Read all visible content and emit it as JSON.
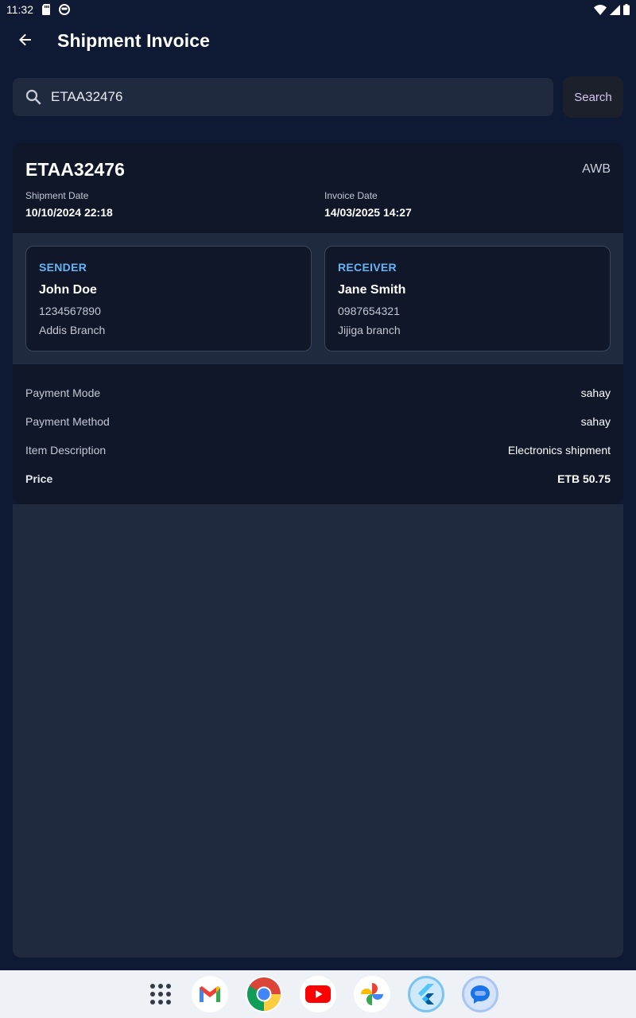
{
  "status_bar": {
    "time": "11:32"
  },
  "header": {
    "title": "Shipment Invoice"
  },
  "search": {
    "value": "ETAA32476",
    "button_label": "Search"
  },
  "invoice": {
    "awb_number": "ETAA32476",
    "awb_type": "AWB",
    "shipment_date_label": "Shipment Date",
    "shipment_date": "10/10/2024 22:18",
    "invoice_date_label": "Invoice Date",
    "invoice_date": "14/03/2025 14:27",
    "sender": {
      "role": "SENDER",
      "name": "John Doe",
      "phone": "1234567890",
      "branch": "Addis Branch"
    },
    "receiver": {
      "role": "RECEIVER",
      "name": "Jane Smith",
      "phone": "0987654321",
      "branch": "Jijiga branch"
    },
    "details": [
      {
        "label": "Payment Mode",
        "value": "sahay"
      },
      {
        "label": "Payment Method",
        "value": "sahay"
      },
      {
        "label": "Item Description",
        "value": "Electronics shipment"
      },
      {
        "label": "Price",
        "value": "ETB 50.75"
      }
    ]
  },
  "dock": {
    "apps": [
      "app-drawer-icon",
      "gmail-icon",
      "chrome-icon",
      "youtube-icon",
      "photos-icon",
      "flutter-icon",
      "messages-icon"
    ]
  },
  "colors": {
    "background": "#0e1a33",
    "surface": "#1f2a3f",
    "card": "#0f1729",
    "accent_blue": "#64b5f6",
    "search_button_text": "#d6c5f2"
  }
}
